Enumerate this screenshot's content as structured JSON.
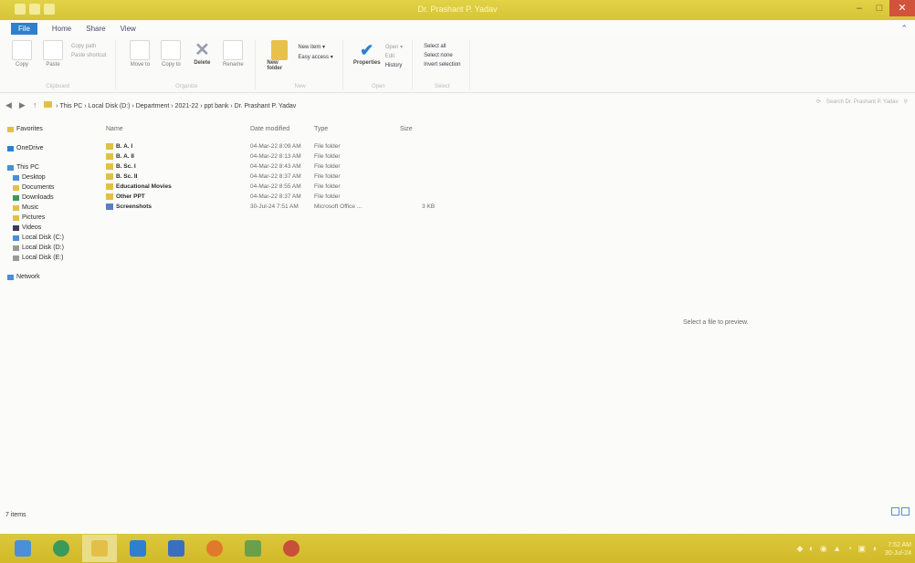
{
  "window": {
    "title": "Dr. Prashant P. Yadav",
    "controls": [
      "–",
      "□",
      "✕"
    ]
  },
  "ribbon": {
    "tabs": [
      "File",
      "Home",
      "Share",
      "View"
    ],
    "clipboard": {
      "copy": "Copy",
      "paste": "Paste",
      "copy_path": "Copy path",
      "paste_shortcut": "Paste shortcut",
      "label": "Clipboard"
    },
    "organize": {
      "move_to": "Move to",
      "copy_to": "Copy to",
      "delete": "Delete",
      "rename": "Rename",
      "label": "Organize"
    },
    "new": {
      "new_folder": "New folder",
      "new_item": "New item ▾",
      "easy_access": "Easy access ▾",
      "label": "New"
    },
    "open": {
      "properties": "Properties",
      "open": "Open ▾",
      "edit": "Edit",
      "history": "History",
      "label": "Open"
    },
    "select": {
      "select_all": "Select all",
      "select_none": "Select none",
      "invert": "Invert selection",
      "label": "Select"
    }
  },
  "address": {
    "crumbs": [
      "This PC",
      "Local Disk (D:)",
      "Department",
      "2021-22",
      "ppt bank",
      "Dr. Prashant P. Yadav"
    ],
    "search_placeholder": "Search Dr. Prashant P. Yadav"
  },
  "nav": {
    "favorites": "Favorites",
    "onedrive": "OneDrive",
    "thispc": "This PC",
    "thispc_items": [
      "Desktop",
      "Documents",
      "Downloads",
      "Music",
      "Pictures",
      "Videos",
      "Local Disk (C:)",
      "Local Disk (D:)",
      "Local Disk (E:)"
    ],
    "network": "Network"
  },
  "columns": {
    "name": "Name",
    "date": "Date modified",
    "type": "Type",
    "size": "Size"
  },
  "files": [
    {
      "name": "B. A. I",
      "date": "04-Mar-22 8:09 AM",
      "type": "File folder",
      "size": "",
      "icon": "folder"
    },
    {
      "name": "B. A. II",
      "date": "04-Mar-22 8:13 AM",
      "type": "File folder",
      "size": "",
      "icon": "folder"
    },
    {
      "name": "B. Sc. I",
      "date": "04-Mar-22 8:43 AM",
      "type": "File folder",
      "size": "",
      "icon": "folder"
    },
    {
      "name": "B. Sc. II",
      "date": "04-Mar-22 8:37 AM",
      "type": "File folder",
      "size": "",
      "icon": "folder"
    },
    {
      "name": "Educational Movies",
      "date": "04-Mar-22 8:55 AM",
      "type": "File folder",
      "size": "",
      "icon": "folder"
    },
    {
      "name": "Other PPT",
      "date": "04-Mar-22 8:37 AM",
      "type": "File folder",
      "size": "",
      "icon": "folder"
    },
    {
      "name": "Screenshots",
      "date": "30-Jul-24 7:51 AM",
      "type": "Microsoft Office ...",
      "size": "3 KB",
      "icon": "document"
    }
  ],
  "preview_text": "Select a file to preview.",
  "status": "7 items",
  "tray": {
    "icons": "◆ ◐ ◉ ▲ ◔ ▣ ◑",
    "time": "7:52 AM",
    "date": "30-Jul-24"
  },
  "colors": {
    "accent": "#2e7fd0",
    "titlebar": "#d9c83c",
    "folder": "#e2c048"
  }
}
